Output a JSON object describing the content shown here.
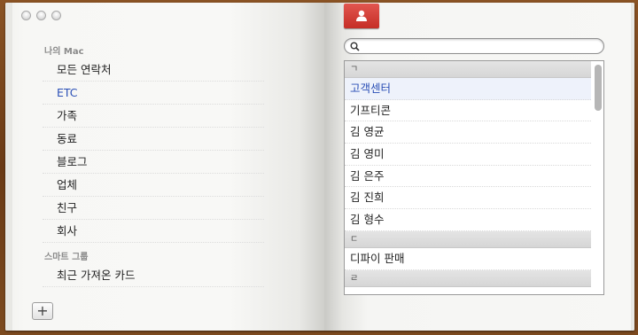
{
  "sidebar": {
    "section_mac": "나의 Mac",
    "groups": [
      "모든 연락처",
      "ETC",
      "가족",
      "동료",
      "블로그",
      "업체",
      "친구",
      "회사"
    ],
    "section_smart": "스마트 그룹",
    "smart_groups": [
      "최근 가져온 카드"
    ],
    "add_button": "+"
  },
  "search": {
    "value": "",
    "placeholder": ""
  },
  "contacts": {
    "sep1": "ㄱ",
    "rows1": [
      "고객센터",
      "기프티콘",
      "김 영균",
      "김 영미",
      "김 은주",
      "김 진희",
      "김 형수"
    ],
    "sep2": "ㄷ",
    "rows2": [
      "디파이 판매"
    ],
    "sep3": "ㄹ"
  },
  "colors": {
    "accent_blue": "#2a4fb6",
    "person_button": "#c62e26",
    "book_leather": "#6b3d18"
  },
  "icons": {
    "person": "person-icon",
    "search": "search-icon",
    "add": "plus-icon"
  }
}
